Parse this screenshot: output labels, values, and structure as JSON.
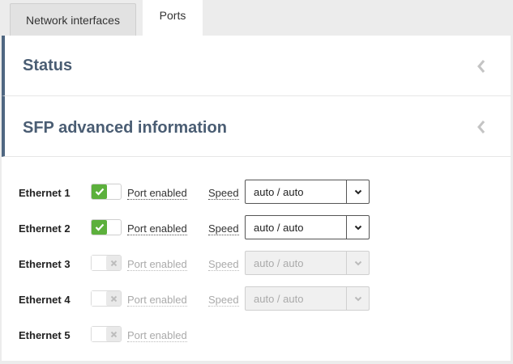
{
  "tabs": [
    {
      "label": "Network interfaces",
      "active": false
    },
    {
      "label": "Ports",
      "active": true
    }
  ],
  "sections": [
    {
      "title": "Status",
      "icon": "chevron-left-icon"
    },
    {
      "title": "SFP advanced information",
      "icon": "chevron-left-icon"
    }
  ],
  "ports": [
    {
      "name": "Ethernet 1",
      "enabled_label": "Port enabled",
      "enabled": true,
      "speed_label": "Speed",
      "speed_value": "auto / auto",
      "speed_disabled": false
    },
    {
      "name": "Ethernet 2",
      "enabled_label": "Port enabled",
      "enabled": true,
      "speed_label": "Speed",
      "speed_value": "auto / auto",
      "speed_disabled": false
    },
    {
      "name": "Ethernet 3",
      "enabled_label": "Port enabled",
      "enabled": false,
      "speed_label": "Speed",
      "speed_value": "auto / auto",
      "speed_disabled": true
    },
    {
      "name": "Ethernet 4",
      "enabled_label": "Port enabled",
      "enabled": false,
      "speed_label": "Speed",
      "speed_value": "auto / auto",
      "speed_disabled": true
    },
    {
      "name": "Ethernet 5",
      "enabled_label": "Port enabled",
      "enabled": false
    }
  ],
  "colors": {
    "accent": "#4f6781",
    "toggle_on": "#5cb03c",
    "section_title": "#4a5d73"
  }
}
